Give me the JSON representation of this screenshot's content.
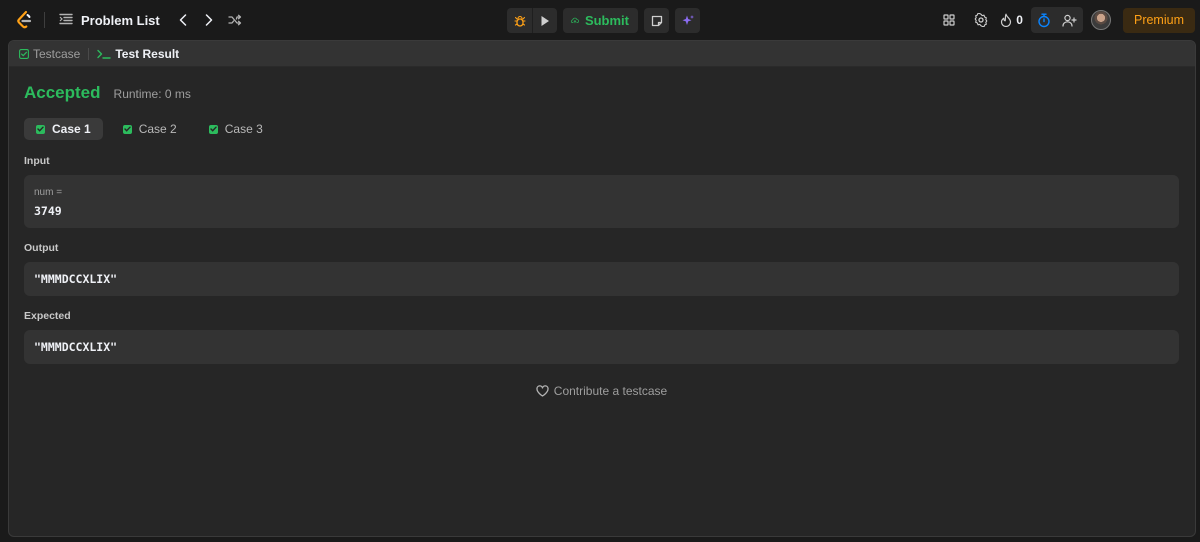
{
  "topbar": {
    "problem_list_label": "Problem List",
    "submit_label": "Submit",
    "streak_count": "0",
    "premium_label": "Premium"
  },
  "panel": {
    "tabs": [
      {
        "label": "Testcase",
        "active": false
      },
      {
        "label": "Test Result",
        "active": true
      }
    ],
    "status": "Accepted",
    "runtime": "Runtime: 0 ms",
    "cases": [
      {
        "label": "Case 1",
        "active": true
      },
      {
        "label": "Case 2",
        "active": false
      },
      {
        "label": "Case 3",
        "active": false
      }
    ],
    "input_label": "Input",
    "input_var_name": "num =",
    "input_var_value": "3749",
    "output_label": "Output",
    "output_value": "\"MMMDCCXLIX\"",
    "expected_label": "Expected",
    "expected_value": "\"MMMDCCXLIX\"",
    "contribute_label": "Contribute a testcase"
  },
  "colors": {
    "accent_green": "#2cbb5d",
    "premium_orange": "#ffa116",
    "timer_blue": "#0a84ff",
    "ai_purple": "#8b6cf0"
  }
}
